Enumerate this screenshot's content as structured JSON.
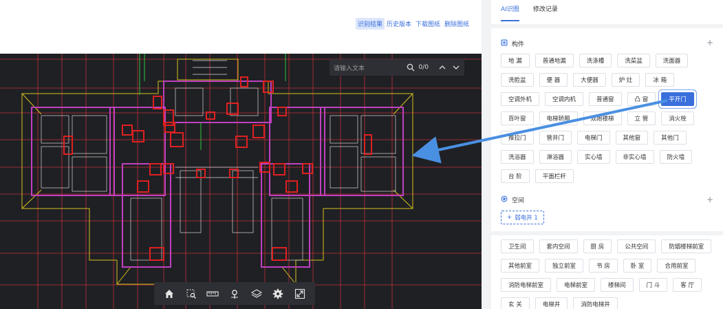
{
  "top_actions": [
    "识别结果",
    "历史版本",
    "下载图纸",
    "删除图纸"
  ],
  "search": {
    "placeholder": "请输入文本",
    "count": "0/0"
  },
  "tabs": [
    "AI识图",
    "修改记录"
  ],
  "components": {
    "title": "构件",
    "items": [
      "地 漏",
      "普通地漏",
      "洗涤槽",
      "洗菜盆",
      "洗面器",
      "洗脸盆",
      "便 器",
      "大便器",
      "炉 灶",
      "冰 箱",
      "空调外机",
      "空调内机",
      "普通窗",
      "凸 窗",
      "平开门",
      "百叶窗",
      "电梯轿厢",
      "双跑楼梯",
      "立 管",
      "消火栓",
      "推拉门",
      "管井门",
      "电梯门",
      "其他窗",
      "其他门",
      "洗浴器",
      "淋浴器",
      "实心墙",
      "非实心墙",
      "防火墙",
      "台 阶",
      "平面栏杆"
    ],
    "selected": "平开门"
  },
  "spaces": {
    "title": "空间",
    "added": "弱电井 1",
    "items": [
      "卫生间",
      "套内空间",
      "厨 房",
      "公共空间",
      "防烟楼梯前室",
      "其他前室",
      "独立前室",
      "书 房",
      "卧 室",
      "合用前室",
      "消防电梯前室",
      "电梯前室",
      "楼梯间",
      "门 斗",
      "客 厅",
      "玄 关",
      "电梯井",
      "消防电梯井"
    ]
  },
  "toolbar_icons": [
    "home-icon",
    "zoom-area-icon",
    "ruler-icon",
    "pin-icon",
    "layers-icon",
    "settings-icon",
    "fullscreen-icon"
  ],
  "colors": {
    "accent": "#3a6fdc",
    "cad_bg": "#1f2024",
    "highlight": "#e02020",
    "arrow": "#4a90e2"
  }
}
